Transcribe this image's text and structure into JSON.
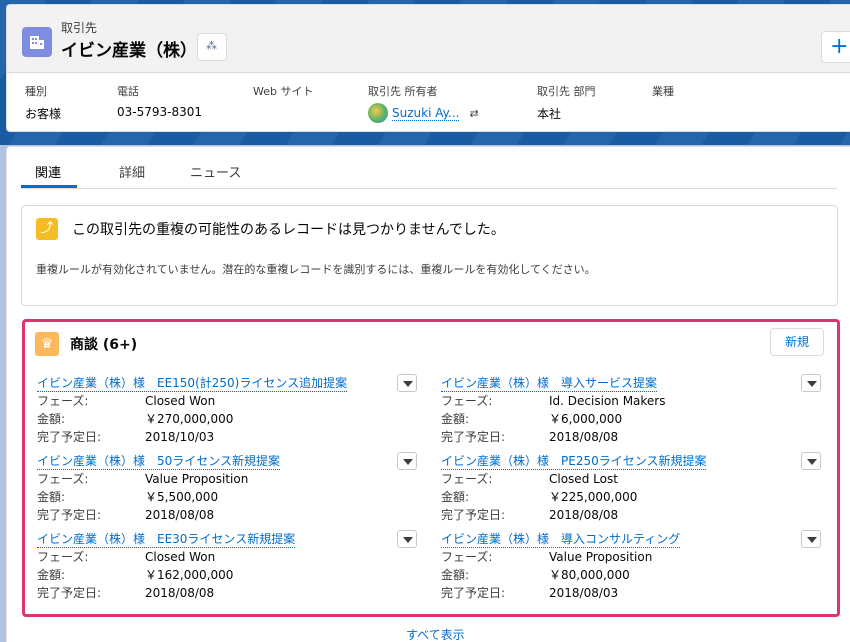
{
  "record": {
    "object_type": "取引先",
    "name": "イビン産業（株）"
  },
  "fields": [
    {
      "label": "種別",
      "value": "お客様"
    },
    {
      "label": "電話",
      "value": "03-5793-8301"
    },
    {
      "label": "Web サイト",
      "value": ""
    },
    {
      "label": "取引先 所有者",
      "value": "Suzuki Ay..."
    },
    {
      "label": "取引先 部門",
      "value": "本社"
    },
    {
      "label": "業種",
      "value": ""
    }
  ],
  "tabs": [
    "関連",
    "詳細",
    "ニュース"
  ],
  "duplicates": {
    "title": "この取引先の重複の可能性のあるレコードは見つかりませんでした。",
    "description": "重複ルールが有効化されていません。潜在的な重複レコードを識別するには、重複ルールを有効化してください。"
  },
  "opportunities": {
    "title": "商談 (6+)",
    "new_label": "新規",
    "field_labels": {
      "phase": "フェーズ:",
      "amount": "金額:",
      "close_date": "完了予定日:"
    },
    "items": [
      {
        "name": "イビン産業（株）様　EE150(計250)ライセンス追加提案",
        "phase": "Closed Won",
        "amount": "￥270,000,000",
        "close_date": "2018/10/03"
      },
      {
        "name": "イビン産業（株）様　導入サービス提案",
        "phase": "Id. Decision Makers",
        "amount": "￥6,000,000",
        "close_date": "2018/08/08"
      },
      {
        "name": "イビン産業（株）様　50ライセンス新規提案",
        "phase": "Value Proposition",
        "amount": "￥5,500,000",
        "close_date": "2018/08/08"
      },
      {
        "name": "イビン産業（株）様　PE250ライセンス新規提案",
        "phase": "Closed Lost",
        "amount": "￥225,000,000",
        "close_date": "2018/08/08"
      },
      {
        "name": "イビン産業（株）様　EE30ライセンス新規提案",
        "phase": "Closed Won",
        "amount": "￥162,000,000",
        "close_date": "2018/08/08"
      },
      {
        "name": "イビン産業（株）様　導入コンサルティング",
        "phase": "Value Proposition",
        "amount": "￥80,000,000",
        "close_date": "2018/08/03"
      }
    ],
    "view_all": "すべて表示"
  },
  "colors": {
    "accent": "#0070d2",
    "highlight": "#e0346a",
    "opportunity_icon": "#fcb95b",
    "account_icon": "#7f8de1"
  },
  "icons": [
    "account-icon",
    "hierarchy-icon",
    "plus-icon",
    "owner-change-icon",
    "duplicate-icon",
    "opportunity-crown-icon",
    "dropdown-icon"
  ]
}
